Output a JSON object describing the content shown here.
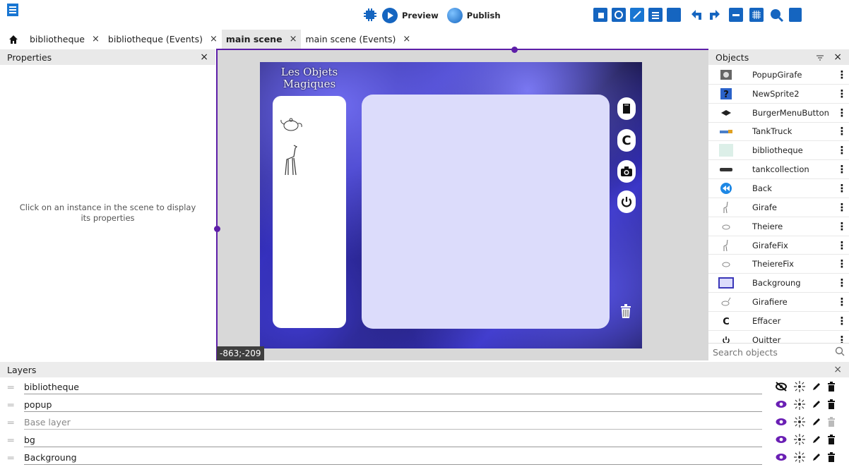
{
  "toolbar": {
    "preview_label": "Preview",
    "publish_label": "Publish",
    "icons": [
      "project-manager-icon",
      "scene-editor-icon",
      "preview-icon",
      "publish-icon",
      "object-groups-icon",
      "properties-icon",
      "instances-list-icon",
      "layers-icon",
      "undo-icon",
      "redo-icon",
      "toggle-window-mask-icon",
      "toggle-grid-icon",
      "zoom-icon",
      "settings-icon"
    ]
  },
  "tabs": [
    {
      "label": "bibliotheque",
      "close": "×"
    },
    {
      "label": "bibliotheque (Events)",
      "close": "×"
    },
    {
      "label": "main scene",
      "close": "×",
      "active": true
    },
    {
      "label": "main scene (Events)",
      "close": "×"
    }
  ],
  "properties": {
    "title": "Properties",
    "close": "×",
    "empty_message": "Click on an instance in the scene to display its properties"
  },
  "scene": {
    "coordinates": "-863;-209",
    "game_title": "Les Objets Magiques"
  },
  "objects": {
    "title": "Objects",
    "close": "×",
    "items": [
      {
        "name": "PopupGirafe",
        "menu": "⋮"
      },
      {
        "name": "NewSprite2",
        "menu": "⋮"
      },
      {
        "name": "BurgerMenuButton",
        "menu": "⋮"
      },
      {
        "name": "TankTruck",
        "menu": "⋮"
      },
      {
        "name": "bibliotheque",
        "menu": "⋮"
      },
      {
        "name": "tankcollection",
        "menu": "⋮"
      },
      {
        "name": "Back",
        "menu": "⋮"
      },
      {
        "name": "Girafe",
        "menu": "⋮"
      },
      {
        "name": "Theiere",
        "menu": "⋮"
      },
      {
        "name": "GirafeFix",
        "menu": "⋮"
      },
      {
        "name": "TheiereFix",
        "menu": "⋮"
      },
      {
        "name": "Backgroung",
        "menu": "⋮"
      },
      {
        "name": "Girafiere",
        "menu": "⋮"
      },
      {
        "name": "Effacer",
        "menu": "⋮"
      },
      {
        "name": "Quitter",
        "menu": "⋮"
      }
    ],
    "search_placeholder": "Search objects"
  },
  "layers": {
    "title": "Layers",
    "close": "×",
    "items": [
      {
        "name": "bibliotheque",
        "visible": false
      },
      {
        "name": "popup",
        "visible": true
      },
      {
        "name": "Base layer",
        "visible": true
      },
      {
        "name": "bg",
        "visible": true
      },
      {
        "name": "Backgroung",
        "visible": true
      }
    ]
  },
  "colors": {
    "accent": "#5d1ea8",
    "toolbar_icon_blue": "#1565c0",
    "game_bg": "#2c27b0",
    "main_area": "#dcdcfb"
  }
}
